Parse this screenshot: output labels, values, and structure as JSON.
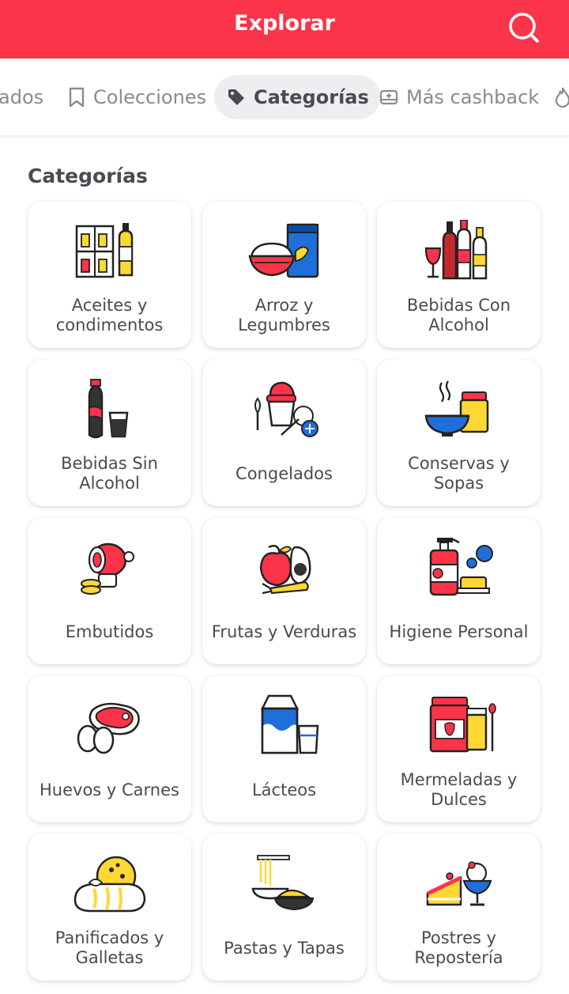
{
  "header": {
    "title": "Explorar"
  },
  "tabs": [
    {
      "label": "ados"
    },
    {
      "label": "Colecciones"
    },
    {
      "label": "Categorías"
    },
    {
      "label": "Más cashback"
    }
  ],
  "section": {
    "title": "Categorías"
  },
  "categories": [
    {
      "label": "Aceites y condimentos",
      "icon": "oil-condiments-icon"
    },
    {
      "label": "Arroz y Legumbres",
      "icon": "rice-legumes-icon"
    },
    {
      "label": "Bebidas Con Alcohol",
      "icon": "alcohol-bottles-icon"
    },
    {
      "label": "Bebidas Sin Alcohol",
      "icon": "soda-bottle-icon"
    },
    {
      "label": "Congelados",
      "icon": "frozen-food-icon"
    },
    {
      "label": "Conservas y Sopas",
      "icon": "soup-jar-icon"
    },
    {
      "label": "Embutidos",
      "icon": "ham-sausage-icon"
    },
    {
      "label": "Frutas y Verduras",
      "icon": "fruits-vegetables-icon"
    },
    {
      "label": "Higiene Personal",
      "icon": "soap-bottle-icon"
    },
    {
      "label": "Huevos y Carnes",
      "icon": "steak-eggs-icon"
    },
    {
      "label": "Lácteos",
      "icon": "milk-carton-icon"
    },
    {
      "label": "Mermeladas y Dulces",
      "icon": "jam-honey-icon"
    },
    {
      "label": "Panificados y Galletas",
      "icon": "bread-cookie-icon"
    },
    {
      "label": "Pastas y Tapas",
      "icon": "pasta-pie-icon"
    },
    {
      "label": "Postres y Repostería",
      "icon": "cake-dessert-icon"
    }
  ],
  "colors": {
    "brand": "#fb3449",
    "text": "#4a4a52",
    "muted": "#8a8a92",
    "accent_yellow": "#fdd835",
    "accent_blue": "#1e6fd9"
  }
}
